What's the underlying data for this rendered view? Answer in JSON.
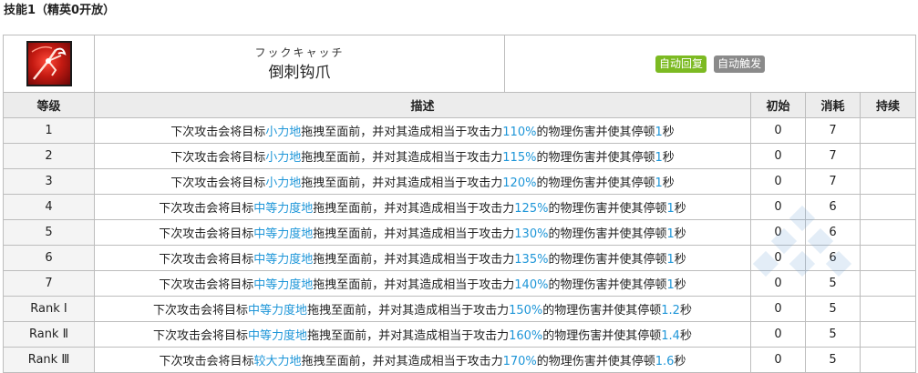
{
  "section_title": "技能1（精英0开放）",
  "skill": {
    "name_jp": "フックキャッチ",
    "name_cn": "倒刺钩爪",
    "icon": "hook-claw-skill-icon",
    "tags": [
      {
        "label": "自动回复",
        "color": "#7cba22"
      },
      {
        "label": "自动触发",
        "color": "#8a8a8a"
      }
    ]
  },
  "columns": {
    "level": "等级",
    "description": "描述",
    "initial": "初始",
    "cost": "消耗",
    "duration": "持续"
  },
  "rows": [
    {
      "level": "1",
      "d1": "下次攻击会将目标",
      "force": "小力地",
      "d2": "拖拽至面前，并对其造成相当于攻击力",
      "pct": "110%",
      "d3": "的物理伤害并使其停顿",
      "sec": "1",
      "d4": "秒",
      "initial": "0",
      "cost": "7",
      "duration": ""
    },
    {
      "level": "2",
      "d1": "下次攻击会将目标",
      "force": "小力地",
      "d2": "拖拽至面前，并对其造成相当于攻击力",
      "pct": "115%",
      "d3": "的物理伤害并使其停顿",
      "sec": "1",
      "d4": "秒",
      "initial": "0",
      "cost": "7",
      "duration": ""
    },
    {
      "level": "3",
      "d1": "下次攻击会将目标",
      "force": "小力地",
      "d2": "拖拽至面前，并对其造成相当于攻击力",
      "pct": "120%",
      "d3": "的物理伤害并使其停顿",
      "sec": "1",
      "d4": "秒",
      "initial": "0",
      "cost": "7",
      "duration": ""
    },
    {
      "level": "4",
      "d1": "下次攻击会将目标",
      "force": "中等力度地",
      "d2": "拖拽至面前，并对其造成相当于攻击力",
      "pct": "125%",
      "d3": "的物理伤害并使其停顿",
      "sec": "1",
      "d4": "秒",
      "initial": "0",
      "cost": "6",
      "duration": ""
    },
    {
      "level": "5",
      "d1": "下次攻击会将目标",
      "force": "中等力度地",
      "d2": "拖拽至面前，并对其造成相当于攻击力",
      "pct": "130%",
      "d3": "的物理伤害并使其停顿",
      "sec": "1",
      "d4": "秒",
      "initial": "0",
      "cost": "6",
      "duration": ""
    },
    {
      "level": "6",
      "d1": "下次攻击会将目标",
      "force": "中等力度地",
      "d2": "拖拽至面前，并对其造成相当于攻击力",
      "pct": "135%",
      "d3": "的物理伤害并使其停顿",
      "sec": "1",
      "d4": "秒",
      "initial": "0",
      "cost": "6",
      "duration": ""
    },
    {
      "level": "7",
      "d1": "下次攻击会将目标",
      "force": "中等力度地",
      "d2": "拖拽至面前，并对其造成相当于攻击力",
      "pct": "140%",
      "d3": "的物理伤害并使其停顿",
      "sec": "1",
      "d4": "秒",
      "initial": "0",
      "cost": "5",
      "duration": ""
    },
    {
      "level": "Rank Ⅰ",
      "d1": "下次攻击会将目标",
      "force": "中等力度地",
      "d2": "拖拽至面前，并对其造成相当于攻击力",
      "pct": "150%",
      "d3": "的物理伤害并使其停顿",
      "sec": "1.2",
      "d4": "秒",
      "initial": "0",
      "cost": "5",
      "duration": ""
    },
    {
      "level": "Rank Ⅱ",
      "d1": "下次攻击会将目标",
      "force": "中等力度地",
      "d2": "拖拽至面前，并对其造成相当于攻击力",
      "pct": "160%",
      "d3": "的物理伤害并使其停顿",
      "sec": "1.4",
      "d4": "秒",
      "initial": "0",
      "cost": "5",
      "duration": ""
    },
    {
      "level": "Rank Ⅲ",
      "d1": "下次攻击会将目标",
      "force": "较大力地",
      "d2": "拖拽至面前，并对其造成相当于攻击力",
      "pct": "170%",
      "d3": "的物理伤害并使其停顿",
      "sec": "1.6",
      "d4": "秒",
      "initial": "0",
      "cost": "5",
      "duration": ""
    }
  ],
  "colors": {
    "highlight": "#1e96d8",
    "header_bg": "#ececec",
    "border": "#bdbdbd"
  }
}
